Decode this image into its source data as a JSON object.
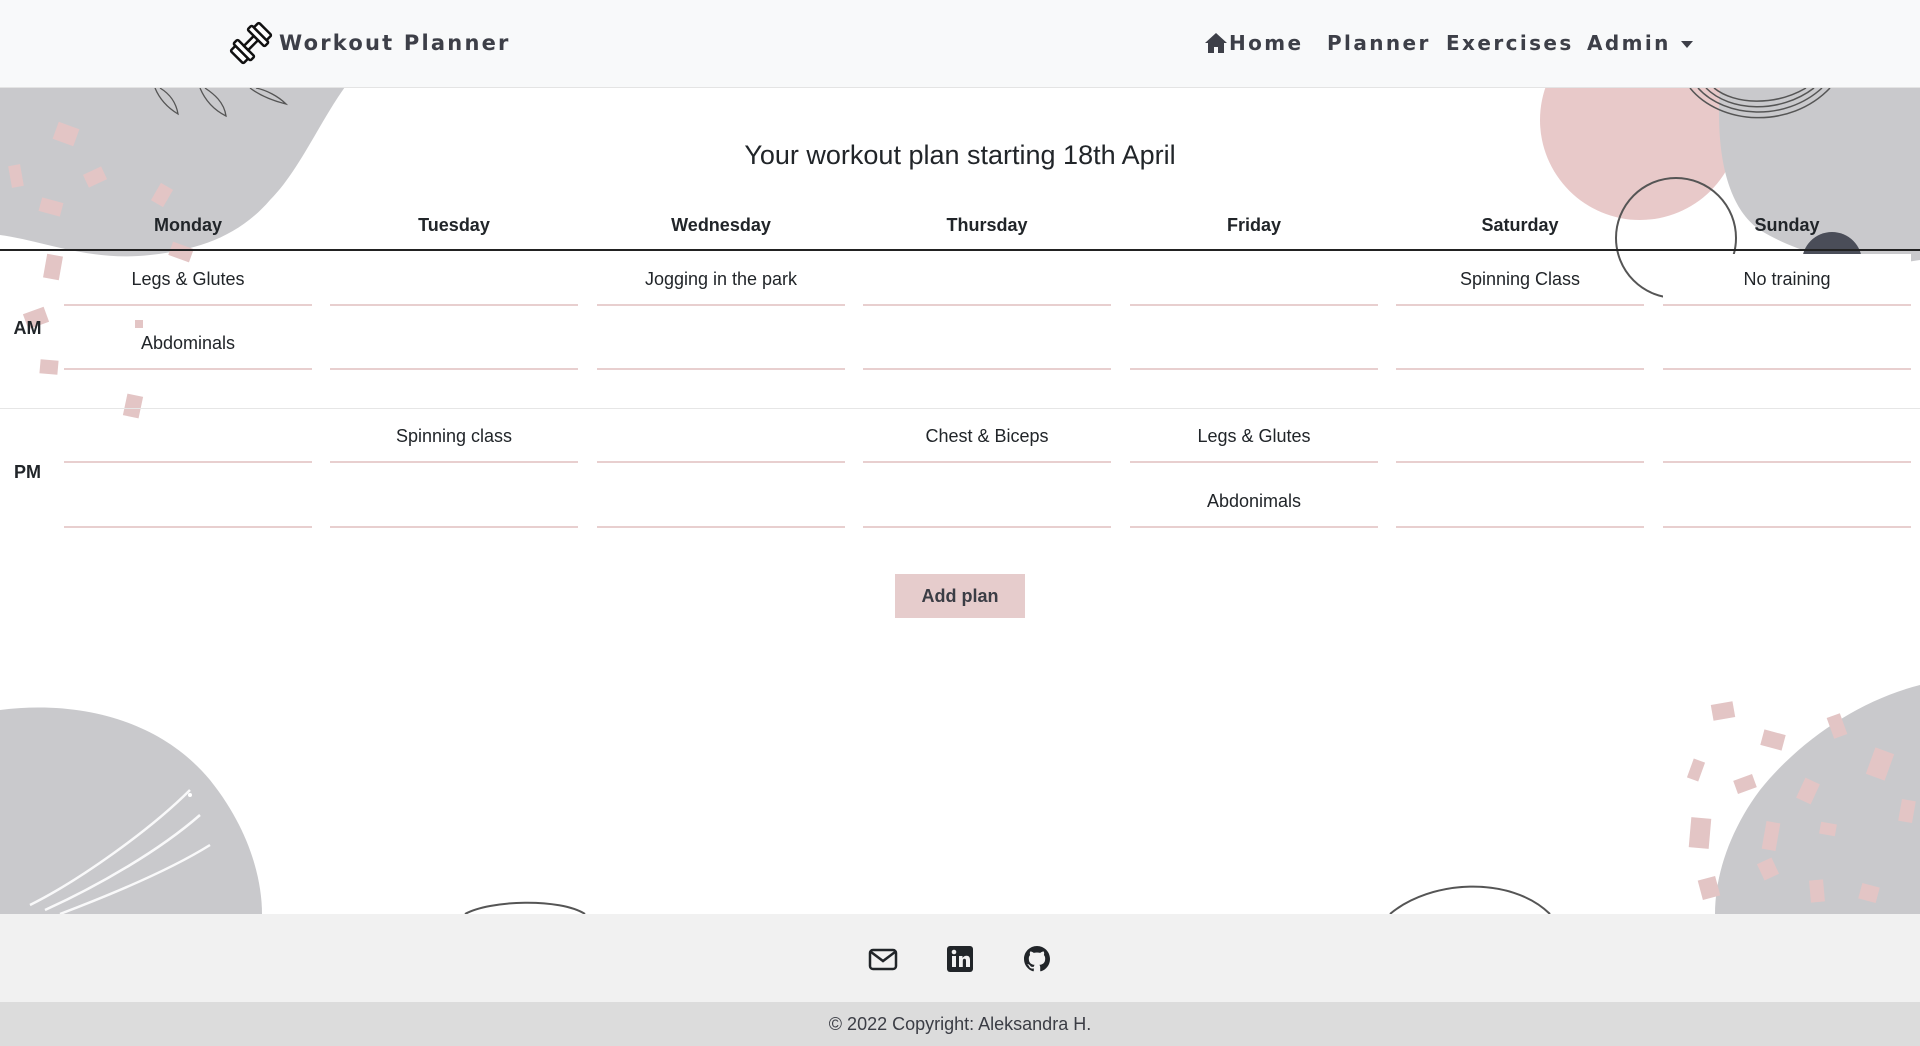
{
  "navbar": {
    "brand": "Workout Planner",
    "brand_icon": "dumbbell-icon",
    "links": {
      "home": "Home",
      "planner": "Planner",
      "exercises": "Exercises",
      "admin": "Admin"
    }
  },
  "plan": {
    "title": "Your workout plan starting 18th April",
    "days": [
      "Monday",
      "Tuesday",
      "Wednesday",
      "Thursday",
      "Friday",
      "Saturday",
      "Sunday"
    ],
    "periods": [
      "AM",
      "PM"
    ],
    "am": [
      [
        "Legs & Glutes",
        "",
        "Jogging in the park",
        "",
        "",
        "Spinning Class",
        "No training"
      ],
      [
        "Abdominals",
        "",
        "",
        "",
        "",
        "",
        ""
      ]
    ],
    "pm": [
      [
        "",
        "Spinning class",
        "",
        "Chest & Biceps",
        "Legs & Glutes",
        "",
        ""
      ],
      [
        "",
        "",
        "",
        "",
        "Abdonimals",
        "",
        ""
      ]
    ],
    "add_button": "Add plan"
  },
  "footer": {
    "icons": [
      "envelope-icon",
      "linkedin-icon",
      "github-icon"
    ],
    "copyright": "© 2022 Copyright: Aleksandra H."
  },
  "colors": {
    "navbar_bg": "#f8f9fa",
    "accent_pink": "#e6cccc",
    "blob_gray": "#c9c9cc",
    "blob_pink": "#e8c9c9",
    "footer_bg": "#f1f1f1",
    "copyright_bg": "#dcdcdc"
  }
}
